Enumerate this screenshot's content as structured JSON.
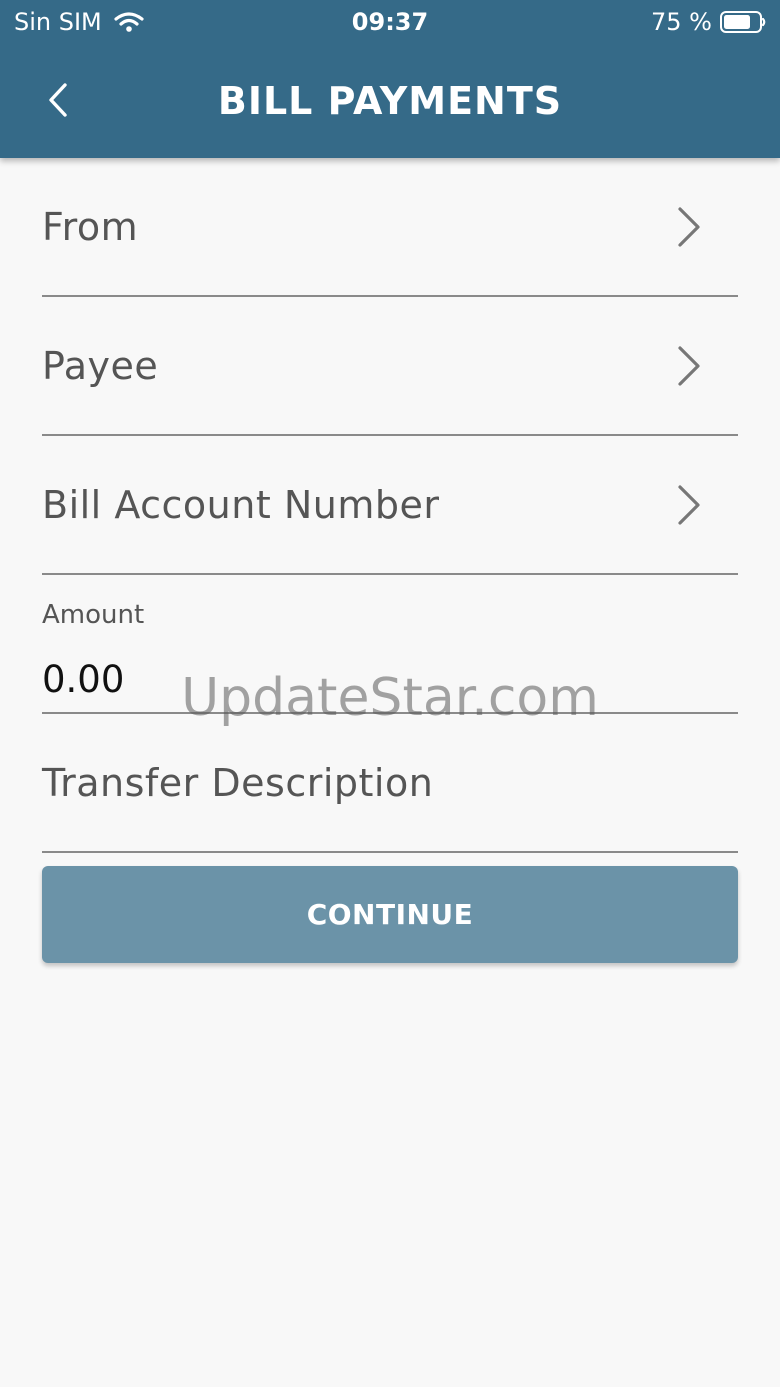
{
  "status_bar": {
    "carrier": "Sin SIM",
    "time": "09:37",
    "battery_percent": "75 %",
    "battery_level": 0.75
  },
  "header": {
    "title": "BILL PAYMENTS",
    "back_icon": "chevron-left-icon"
  },
  "form": {
    "from_label": "From",
    "payee_label": "Payee",
    "bill_account_label": "Bill Account Number",
    "amount_label": "Amount",
    "amount_value": "0.00",
    "description_label": "Transfer Description"
  },
  "actions": {
    "continue_label": "CONTINUE"
  },
  "watermark": "UpdateStar.com",
  "colors": {
    "header_bg": "#356a88",
    "button_bg": "#6b93a8",
    "page_bg": "#f8f8f8"
  }
}
